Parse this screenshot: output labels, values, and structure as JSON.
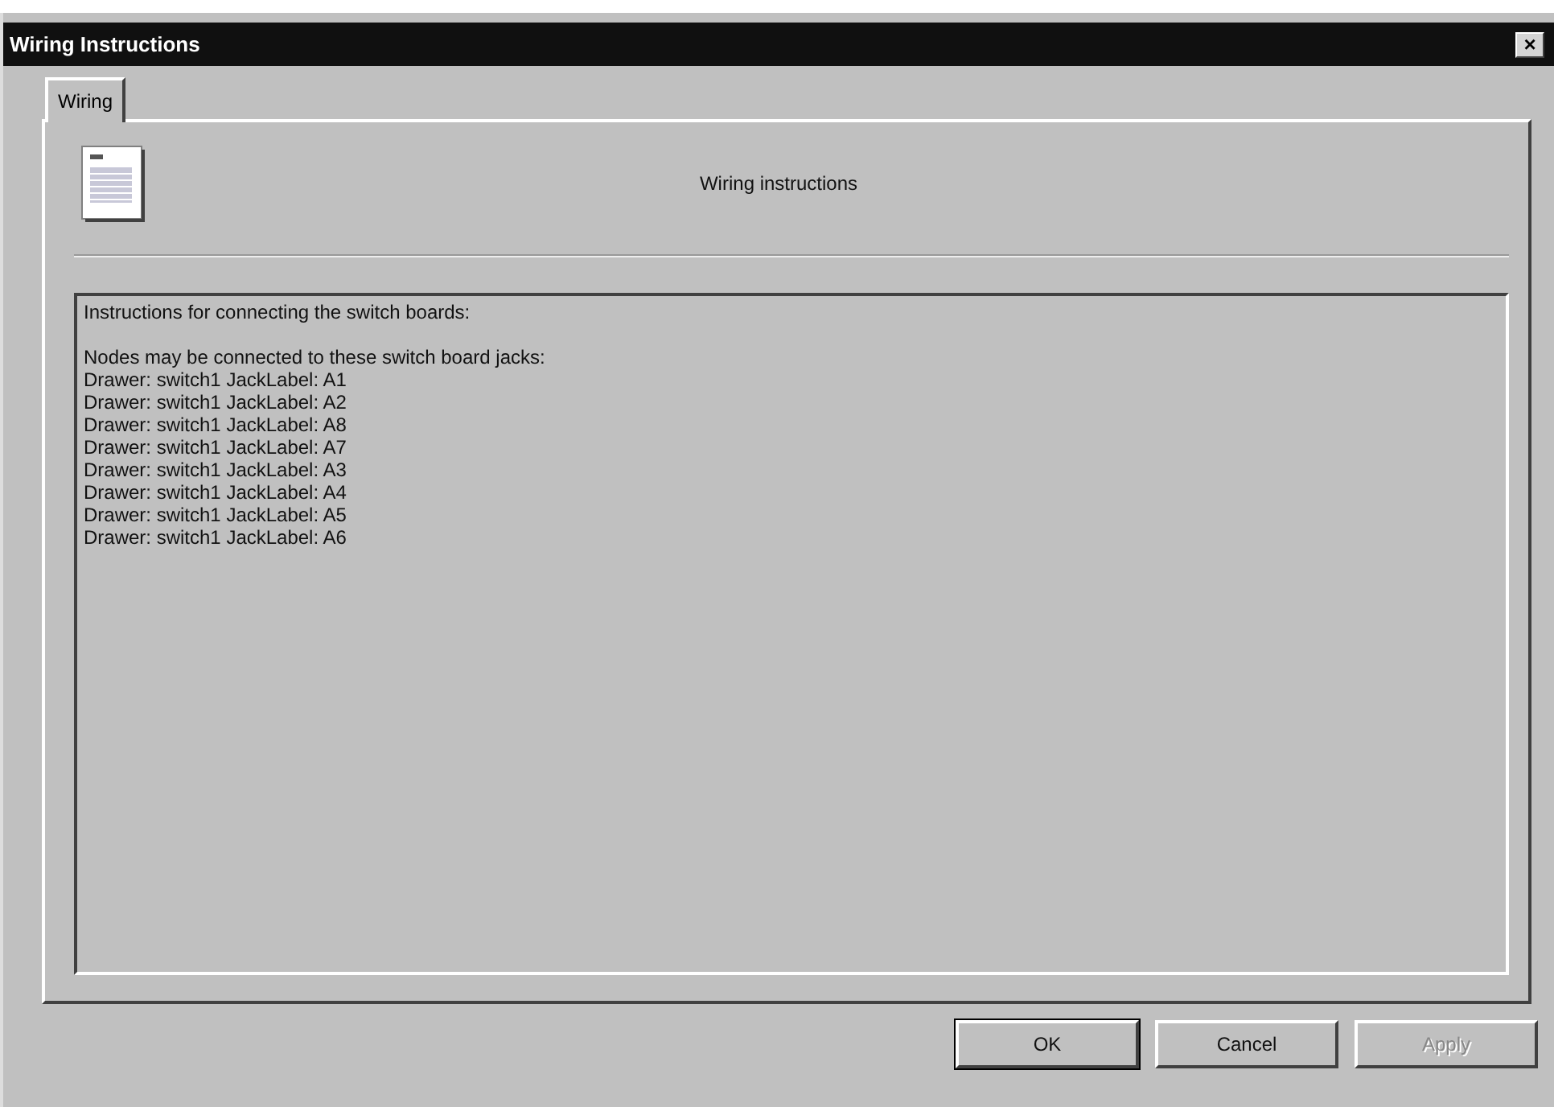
{
  "window": {
    "title": "Wiring Instructions",
    "close": "×"
  },
  "tabs": [
    {
      "label": "Wiring",
      "selected": true
    }
  ],
  "header": {
    "caption": "Wiring instructions"
  },
  "instructions": {
    "heading": "Instructions for connecting the switch boards:",
    "intro": "Nodes may be connected to these switch board jacks:",
    "lines": [
      "Drawer: switch1 JackLabel: A1",
      "Drawer: switch1 JackLabel: A2",
      "Drawer: switch1 JackLabel: A8",
      "Drawer: switch1 JackLabel: A7",
      "Drawer: switch1 JackLabel: A3",
      "Drawer: switch1 JackLabel: A4",
      "Drawer: switch1 JackLabel: A5",
      "Drawer: switch1 JackLabel: A6"
    ]
  },
  "buttons": [
    {
      "label": "OK",
      "disabled": false,
      "default": true
    },
    {
      "label": "Cancel",
      "disabled": false,
      "default": false
    },
    {
      "label": "Apply",
      "disabled": true,
      "default": false
    }
  ]
}
